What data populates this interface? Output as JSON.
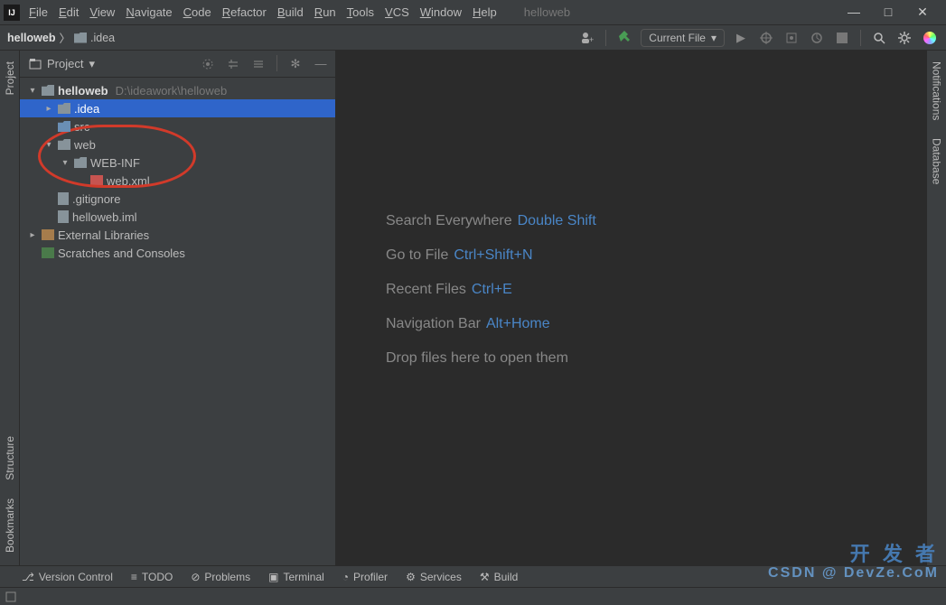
{
  "app": {
    "name": "helloweb",
    "logo_text": "IJ"
  },
  "menu": [
    "File",
    "Edit",
    "View",
    "Navigate",
    "Code",
    "Refactor",
    "Build",
    "Run",
    "Tools",
    "VCS",
    "Window",
    "Help"
  ],
  "window_controls": {
    "min": "—",
    "max": "□",
    "close": "✕"
  },
  "breadcrumb": {
    "root": "helloweb",
    "sep": "〉",
    "item": ".idea"
  },
  "toolbar": {
    "current_file": "Current File"
  },
  "sidebar": {
    "title": "Project",
    "tree": [
      {
        "depth": 0,
        "arrow": "▾",
        "icon": "folder",
        "label": "helloweb",
        "hint": "D:\\ideawork\\helloweb",
        "selected": false,
        "bold": true
      },
      {
        "depth": 1,
        "arrow": "▸",
        "icon": "folder",
        "label": ".idea",
        "selected": true
      },
      {
        "depth": 1,
        "arrow": "",
        "icon": "folder-blue",
        "label": "src"
      },
      {
        "depth": 1,
        "arrow": "▾",
        "icon": "folder",
        "label": "web"
      },
      {
        "depth": 2,
        "arrow": "▾",
        "icon": "folder",
        "label": "WEB-INF"
      },
      {
        "depth": 3,
        "arrow": "",
        "icon": "xml",
        "label": "web.xml"
      },
      {
        "depth": 1,
        "arrow": "",
        "icon": "file",
        "label": ".gitignore"
      },
      {
        "depth": 1,
        "arrow": "",
        "icon": "file",
        "label": "helloweb.iml"
      },
      {
        "depth": 0,
        "arrow": "▸",
        "icon": "lib",
        "label": "External Libraries"
      },
      {
        "depth": 0,
        "arrow": "",
        "icon": "scratch",
        "label": "Scratches and Consoles"
      }
    ]
  },
  "tips": [
    {
      "label": "Search Everywhere",
      "kb": "Double Shift"
    },
    {
      "label": "Go to File",
      "kb": "Ctrl+Shift+N"
    },
    {
      "label": "Recent Files",
      "kb": "Ctrl+E"
    },
    {
      "label": "Navigation Bar",
      "kb": "Alt+Home"
    },
    {
      "label": "Drop files here to open them",
      "kb": ""
    }
  ],
  "left_gutter": [
    {
      "label": "Project"
    },
    {
      "label": "Structure"
    },
    {
      "label": "Bookmarks"
    }
  ],
  "right_gutter": [
    {
      "label": "Notifications"
    },
    {
      "label": "Database"
    }
  ],
  "bottom_tabs": [
    "Version Control",
    "TODO",
    "Problems",
    "Terminal",
    "Profiler",
    "Services",
    "Build"
  ],
  "status": {
    "watermark_cn": "开 发 者",
    "watermark_en": "CSDN @ DevZe.CoM"
  }
}
